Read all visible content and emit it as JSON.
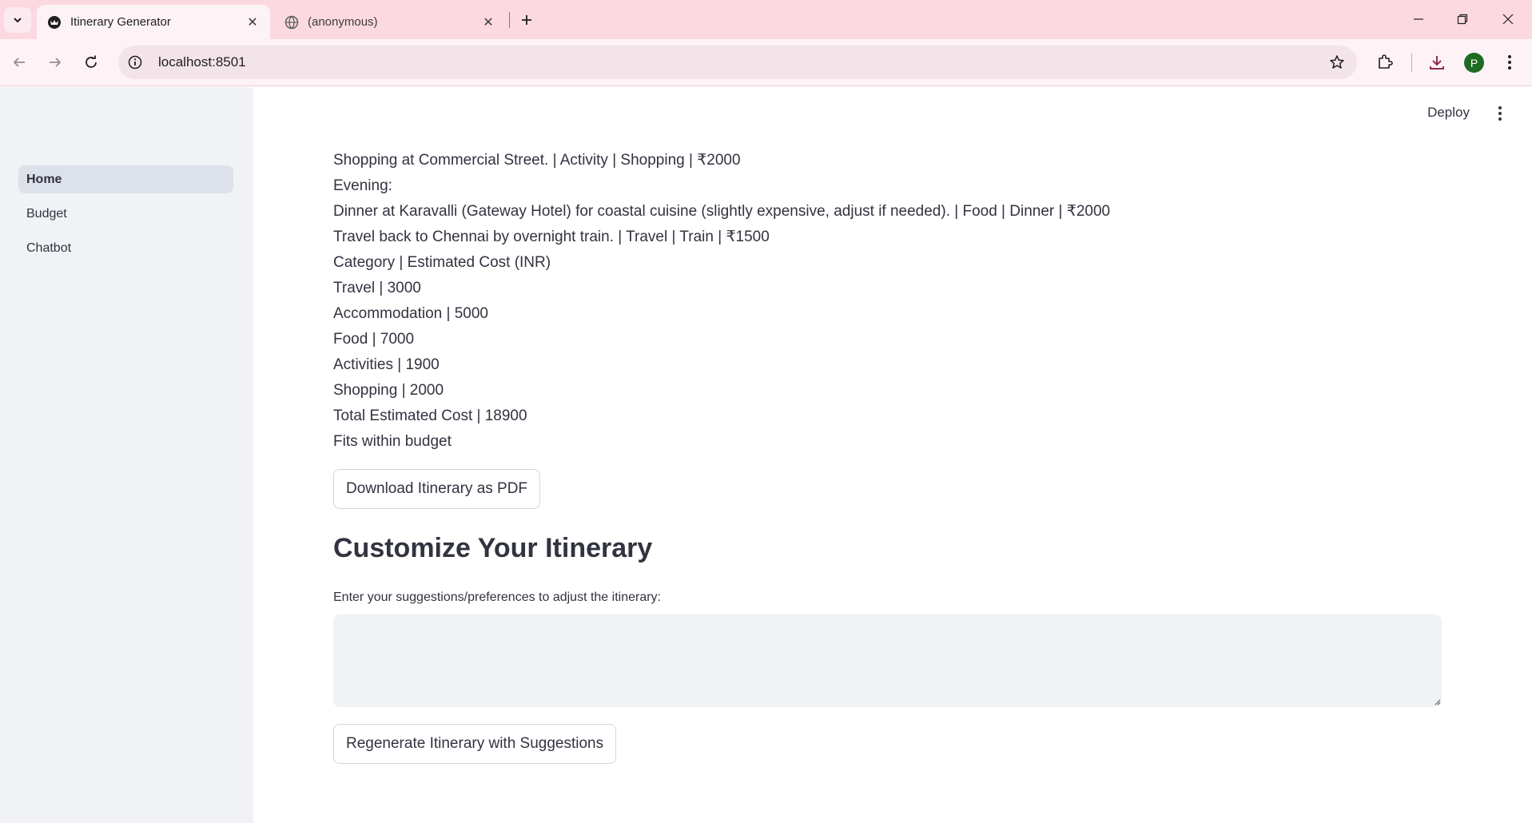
{
  "browser": {
    "tabs": [
      {
        "title": "Itinerary Generator",
        "active": true,
        "icon": "streamlit-icon"
      },
      {
        "title": "(anonymous)",
        "active": false,
        "icon": "globe-icon"
      }
    ],
    "url": "localhost:8501",
    "profile_initial": "P"
  },
  "sidebar": {
    "items": [
      {
        "label": "Home",
        "active": true
      },
      {
        "label": "Budget",
        "active": false
      },
      {
        "label": "Chatbot",
        "active": false
      }
    ]
  },
  "header": {
    "deploy_label": "Deploy"
  },
  "itinerary": {
    "lines": [
      "Shopping at Commercial Street. | Activity | Shopping | ₹2000",
      "Evening:",
      "Dinner at Karavalli (Gateway Hotel) for coastal cuisine (slightly expensive, adjust if needed). | Food | Dinner | ₹2000",
      "Travel back to Chennai by overnight train. | Travel | Train | ₹1500",
      "Category | Estimated Cost (INR)",
      "Travel | 3000",
      "Accommodation | 5000",
      "Food | 7000",
      "Activities | 1900",
      "Shopping | 2000",
      "Total Estimated Cost | 18900",
      "Fits within budget"
    ]
  },
  "actions": {
    "download_pdf_label": "Download Itinerary as PDF",
    "regenerate_label": "Regenerate Itinerary with Suggestions"
  },
  "customize": {
    "heading": "Customize Your Itinerary",
    "field_label": "Enter your suggestions/preferences to adjust the itinerary:",
    "field_value": ""
  },
  "colors": {
    "tabbar_bg": "#fcd9e1",
    "sidebar_bg": "#f0f2f6",
    "text": "#31333f"
  }
}
